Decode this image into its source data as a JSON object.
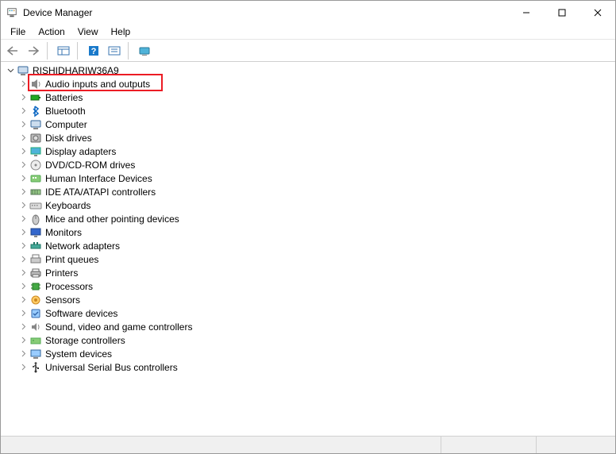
{
  "window": {
    "title": "Device Manager"
  },
  "menu": {
    "items": [
      "File",
      "Action",
      "View",
      "Help"
    ]
  },
  "toolbar": {
    "buttons": [
      {
        "name": "back-icon"
      },
      {
        "name": "forward-icon"
      },
      {
        "name": "show-hidden-icon"
      },
      {
        "name": "help-icon"
      },
      {
        "name": "console-tree-icon"
      },
      {
        "name": "devices-icon"
      }
    ]
  },
  "tree": {
    "root": {
      "label": "RISHIDHARIW36A9",
      "icon": "computer-icon",
      "expanded": true
    },
    "children": [
      {
        "label": "Audio inputs and outputs",
        "icon": "audio-icon",
        "highlighted": true
      },
      {
        "label": "Batteries",
        "icon": "battery-icon"
      },
      {
        "label": "Bluetooth",
        "icon": "bluetooth-icon"
      },
      {
        "label": "Computer",
        "icon": "computer-icon"
      },
      {
        "label": "Disk drives",
        "icon": "disk-icon"
      },
      {
        "label": "Display adapters",
        "icon": "display-icon"
      },
      {
        "label": "DVD/CD-ROM drives",
        "icon": "dvd-icon"
      },
      {
        "label": "Human Interface Devices",
        "icon": "hid-icon"
      },
      {
        "label": "IDE ATA/ATAPI controllers",
        "icon": "ide-icon"
      },
      {
        "label": "Keyboards",
        "icon": "keyboard-icon"
      },
      {
        "label": "Mice and other pointing devices",
        "icon": "mouse-icon"
      },
      {
        "label": "Monitors",
        "icon": "monitor-icon"
      },
      {
        "label": "Network adapters",
        "icon": "network-icon"
      },
      {
        "label": "Print queues",
        "icon": "printqueue-icon"
      },
      {
        "label": "Printers",
        "icon": "printer-icon"
      },
      {
        "label": "Processors",
        "icon": "cpu-icon"
      },
      {
        "label": "Sensors",
        "icon": "sensor-icon"
      },
      {
        "label": "Software devices",
        "icon": "software-icon"
      },
      {
        "label": "Sound, video and game controllers",
        "icon": "sound-icon"
      },
      {
        "label": "Storage controllers",
        "icon": "storage-icon"
      },
      {
        "label": "System devices",
        "icon": "system-icon"
      },
      {
        "label": "Universal Serial Bus controllers",
        "icon": "usb-icon"
      }
    ]
  }
}
